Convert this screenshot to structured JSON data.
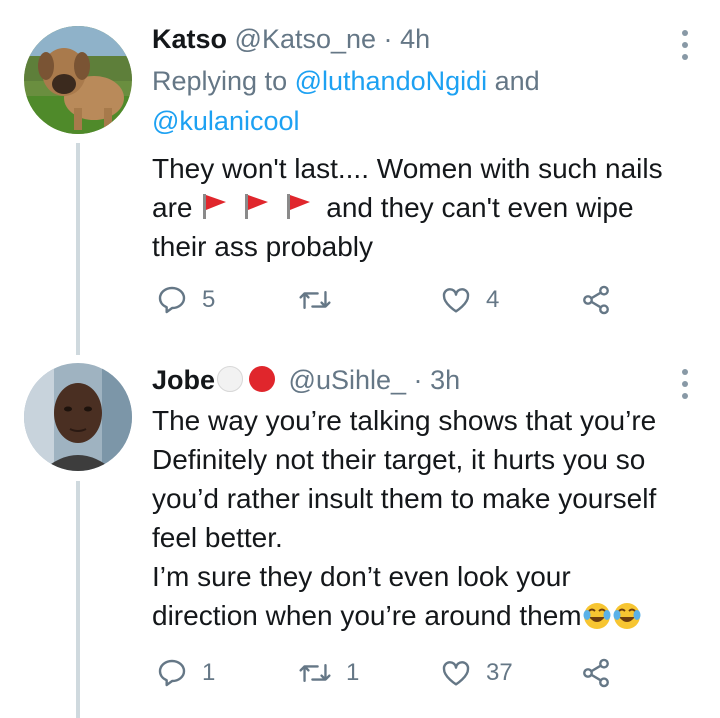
{
  "tweets": [
    {
      "name": "Katso",
      "handle": "@Katso_ne",
      "dot": "·",
      "time": "4h",
      "replying_prefix": "Replying to ",
      "mention1": "@luthandoNgidi",
      "mention_join": " and",
      "mention2": "@kulanicool",
      "text_part1": "They won't last.... Women with such nails are",
      "text_part2": "and they can't even wipe their ass probably",
      "emoji_inline": [
        "red-triangular-flag",
        "red-triangular-flag",
        "red-triangular-flag"
      ],
      "actions": {
        "reply_count": "5",
        "retweet_count": "",
        "like_count": "4"
      }
    },
    {
      "name": "Jobe",
      "name_emoji": [
        "white-circle",
        "red-circle"
      ],
      "handle": "@uSihle_",
      "dot": "·",
      "time": "3h",
      "text_line1": "The way you’re talking shows that you’re Definitely not their target, it hurts you so you’d rather insult them to make yourself feel better.",
      "text_line2": "I’m sure they don’t even look your direction when you’re around them",
      "emoji_trailing": [
        "face-with-tears-of-joy",
        "face-with-tears-of-joy"
      ],
      "actions": {
        "reply_count": "1",
        "retweet_count": "1",
        "like_count": "37"
      }
    }
  ],
  "colors": {
    "link": "#1da1f2",
    "secondary_text": "#657786",
    "primary_text": "#14171a",
    "thread_line": "#cfd9de",
    "flag_red": "#e0262c"
  },
  "icons": [
    "reply-icon",
    "retweet-icon",
    "like-icon",
    "share-icon",
    "more-icon"
  ]
}
